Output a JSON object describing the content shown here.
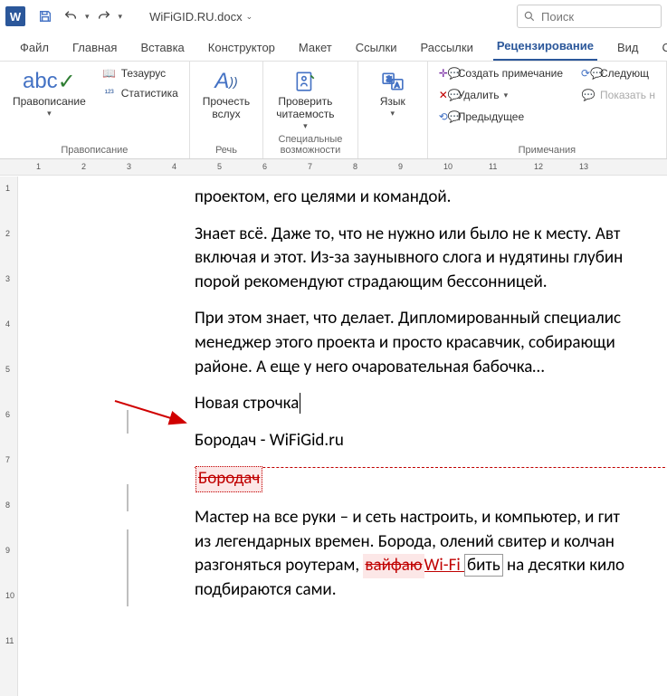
{
  "titlebar": {
    "doc_name": "WiFiGID.RU.docx",
    "search_placeholder": "Поиск"
  },
  "tabs": {
    "file": "Файл",
    "home": "Главная",
    "insert": "Вставка",
    "design": "Конструктор",
    "layout": "Макет",
    "references": "Ссылки",
    "mailings": "Рассылки",
    "review": "Рецензирование",
    "view": "Вид",
    "help": "Справка"
  },
  "ribbon": {
    "proofing": {
      "spelling": "Правописание",
      "thesaurus": "Тезаурус",
      "statistics": "Статистика",
      "group": "Правописание"
    },
    "speech": {
      "read_aloud": "Прочесть\nвслух",
      "group": "Речь"
    },
    "accessibility": {
      "check": "Проверить\nчитаемость",
      "group": "Специальные возможности"
    },
    "language": {
      "language": "Язык",
      "group": ""
    },
    "comments": {
      "new_comment": "Создать примечание",
      "delete": "Удалить",
      "previous": "Предыдущее",
      "next": "Следующ",
      "show": "Показать н",
      "group": "Примечания"
    }
  },
  "ruler_marks": [
    "1",
    "2",
    "3",
    "4",
    "5",
    "6",
    "7",
    "8",
    "9",
    "10",
    "11",
    "12",
    "13"
  ],
  "vruler_marks": [
    "1",
    "2",
    "3",
    "4",
    "5",
    "6",
    "7",
    "8",
    "9",
    "10",
    "11"
  ],
  "document": {
    "p1": "проектом, его целями и командой.",
    "p2": "Знает всё. Даже то, что не нужно или было не к месту. Авт",
    "p3": "включая и этот. Из-за заунывного слога и нудятины глубин",
    "p4": "порой рекомендуют страдающим бессонницей.",
    "p5": "При этом знает, что делает. Дипломированный специалис",
    "p6": "менеджер этого проекта и просто красавчик, собирающи",
    "p7": "районе. А еще у него очаровательная бабочка…",
    "p8_new_line": "Новая строчка",
    "p9": "Бородач - WiFiGid.ru",
    "p10_deleted": "Бородач",
    "p11a": "Мастер на все руки – и сеть настроить, и компьютер, и гит",
    "p11b": "из легендарных времен. Борода, олений свитер и колчан ",
    "p11c_a": "разгоняться роутерам, ",
    "p11c_del": "вайфаю ",
    "p11c_ins": "Wi-Fi ",
    "p11c_box": "бить",
    "p11c_b": " на десятки кило",
    "p11d": "подбираются сами."
  }
}
